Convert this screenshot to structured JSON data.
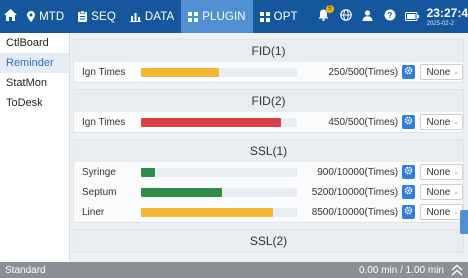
{
  "topbar": {
    "tabs": [
      {
        "label": "MTD",
        "icon": "pin-icon",
        "active": false
      },
      {
        "label": "SEQ",
        "icon": "clipboard-icon",
        "active": false
      },
      {
        "label": "DATA",
        "icon": "bar-chart-icon",
        "active": false
      },
      {
        "label": "PLUGIN",
        "icon": "grid-icon",
        "active": true
      },
      {
        "label": "OPT",
        "icon": "grid-icon",
        "active": false
      }
    ],
    "notification_count": "5",
    "time": "23:27:4",
    "date": "2025-02-2"
  },
  "sidebar": {
    "items": [
      {
        "label": "CtlBoard",
        "active": false
      },
      {
        "label": "Reminder",
        "active": true
      },
      {
        "label": "StatMon",
        "active": false
      },
      {
        "label": "ToDesk",
        "active": false
      }
    ]
  },
  "cards": [
    {
      "title": "FID(1)",
      "rows": [
        {
          "label": "Ign Times",
          "value": "250/500(Times)",
          "fraction": 0.5,
          "color": "#f5b731",
          "select": "None"
        }
      ]
    },
    {
      "title": "FID(2)",
      "rows": [
        {
          "label": "Ign Times",
          "value": "450/500(Times)",
          "fraction": 0.9,
          "color": "#dc3f4a",
          "select": "None"
        }
      ]
    },
    {
      "title": "SSL(1)",
      "rows": [
        {
          "label": "Syringe",
          "value": "900/10000(Times)",
          "fraction": 0.09,
          "color": "#2f8b4a",
          "select": "None"
        },
        {
          "label": "Septum",
          "value": "5200/10000(Times)",
          "fraction": 0.52,
          "color": "#2f8b4a",
          "select": "None"
        },
        {
          "label": "Liner",
          "value": "8500/10000(Times)",
          "fraction": 0.85,
          "color": "#f5b731",
          "select": "None"
        }
      ]
    },
    {
      "title": "SSL(2)",
      "rows": []
    }
  ],
  "statusbar": {
    "mode": "Standard",
    "timer": "0.00 min / 1.00 min"
  }
}
